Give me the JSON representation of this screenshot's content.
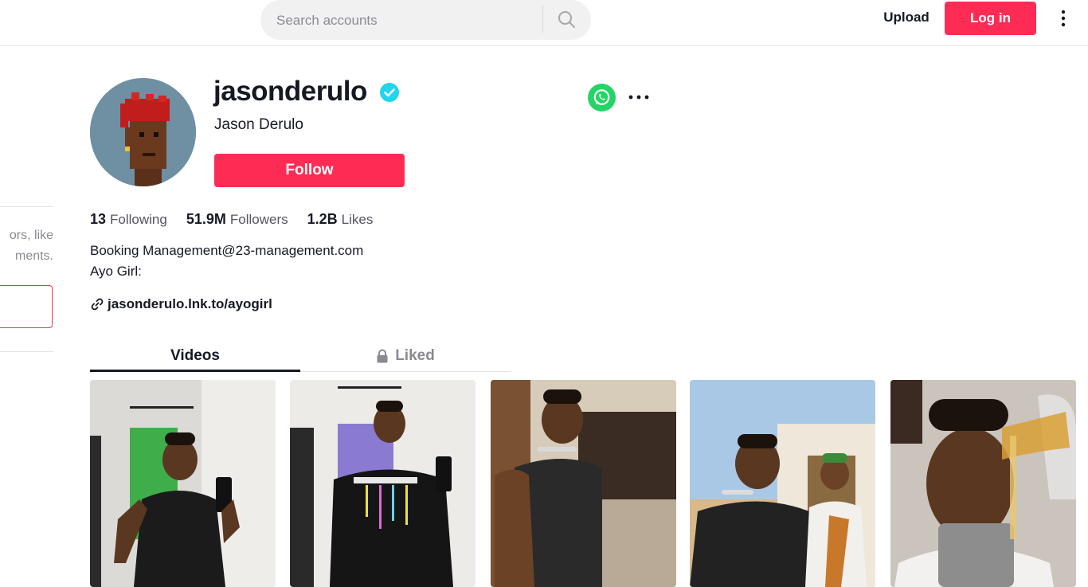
{
  "header": {
    "search_placeholder": "Search accounts",
    "upload_label": "Upload",
    "login_label": "Log in"
  },
  "sidebar": {
    "text_lines": [
      "ors, like",
      "ments."
    ]
  },
  "profile": {
    "username": "jasonderulo",
    "display_name": "Jason Derulo",
    "follow_label": "Follow",
    "stats": {
      "following_count": "13",
      "following_label": "Following",
      "followers_count": "51.9M",
      "followers_label": "Followers",
      "likes_count": "1.2B",
      "likes_label": "Likes"
    },
    "bio_lines": [
      "Booking Management@23-management.com",
      "Ayo Girl:"
    ],
    "link": "jasonderulo.lnk.to/ayogirl"
  },
  "tabs": [
    {
      "label": "Videos",
      "active": true
    },
    {
      "label": "Liked",
      "locked": true
    }
  ],
  "colors": {
    "brand": "#fe2c55",
    "verified": "#20d5ec",
    "whatsapp": "#25d366"
  }
}
